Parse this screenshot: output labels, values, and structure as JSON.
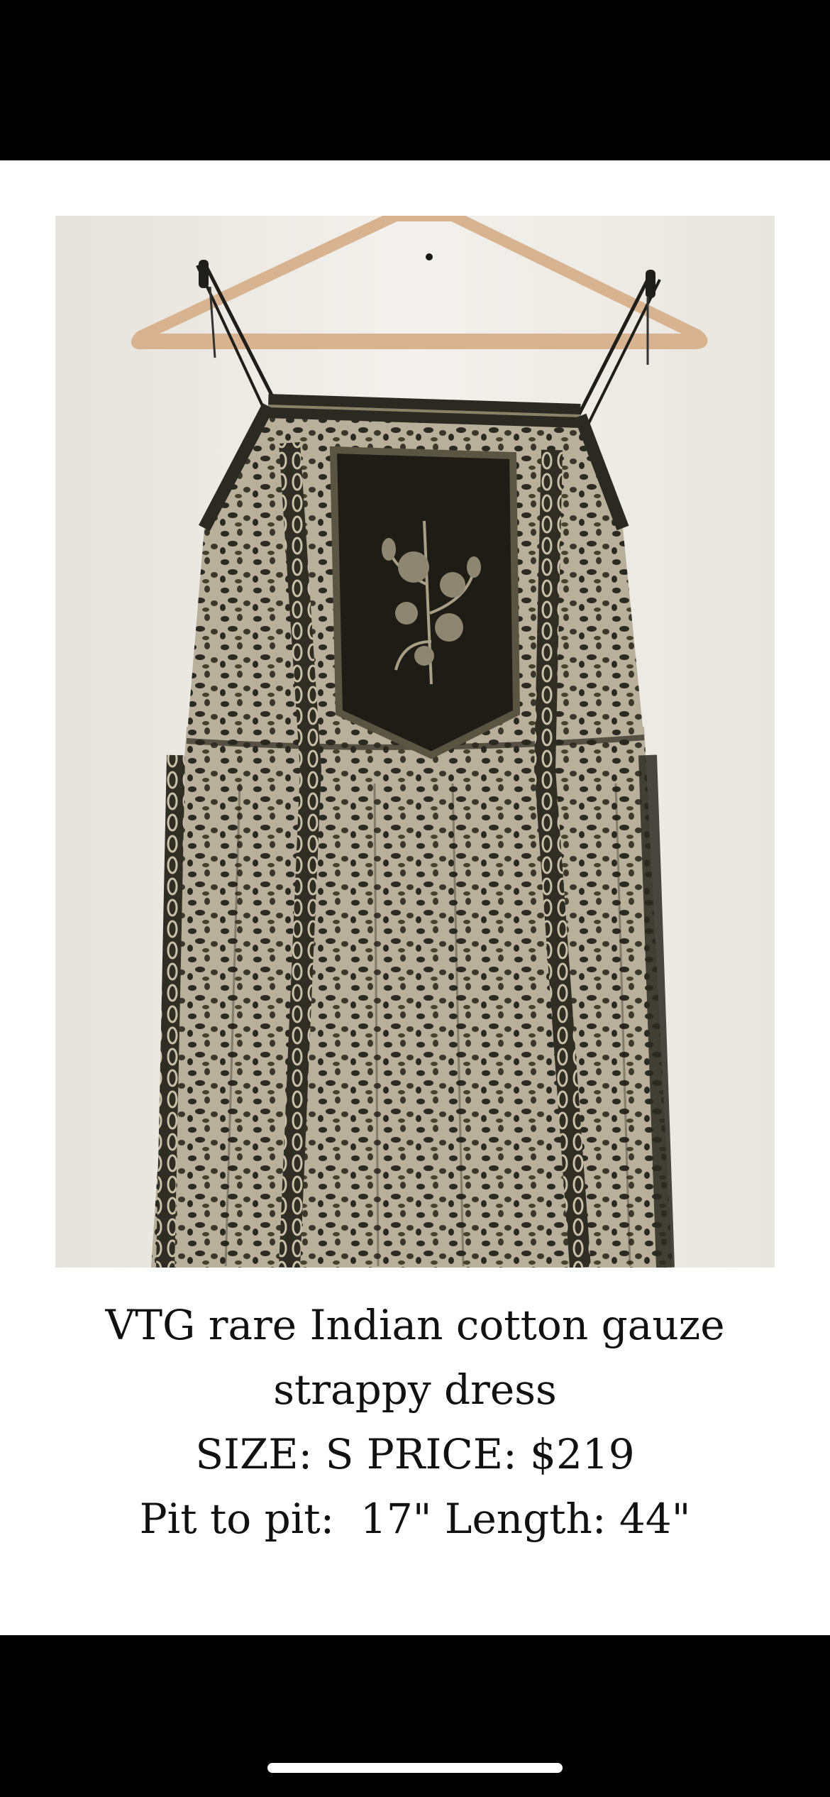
{
  "listing": {
    "title_line_1": "VTG rare Indian cotton gauze",
    "title_line_2": "strappy dress",
    "size_price_line": "SIZE: S PRICE: $219",
    "measurements_line": "Pit to pit:  17\" Length: 44\""
  },
  "colors": {
    "background": "#ffffff",
    "wall": "#efede8",
    "dress_dark": "#2b2a22",
    "dress_print_light": "#b8b09a",
    "hanger": "#d8b38f"
  },
  "icons": {
    "photo": "dress-photo",
    "home_indicator": "home-indicator-bar"
  }
}
